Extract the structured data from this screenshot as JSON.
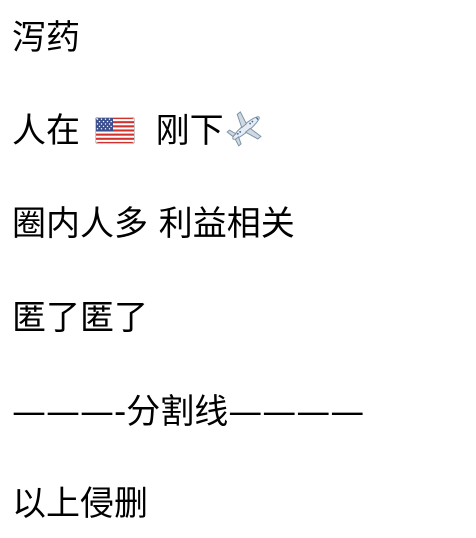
{
  "post": {
    "lines": [
      {
        "text": "泻药"
      },
      {
        "before": "人在",
        "flag_icon": "us-flag-icon",
        "after": "刚下",
        "plane_icon": "airplane-icon"
      },
      {
        "text": "圈内人多 利益相关"
      },
      {
        "text": "匿了匿了"
      },
      {
        "text": "———-分割线————"
      },
      {
        "text": "以上侵删"
      }
    ]
  }
}
